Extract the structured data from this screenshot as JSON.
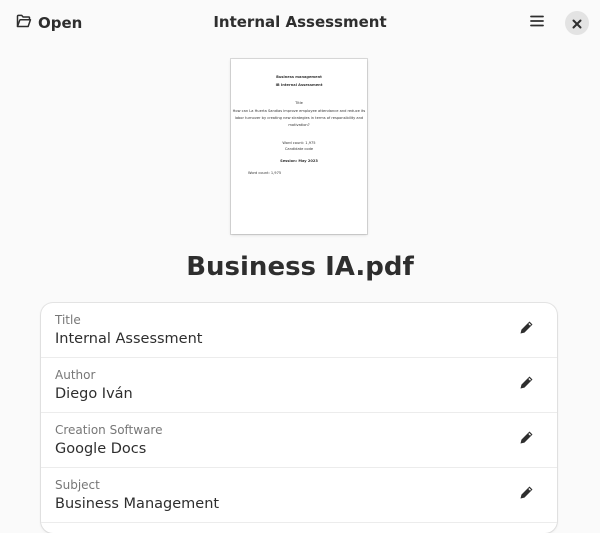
{
  "header": {
    "open_label": "Open",
    "title": "Internal Assessment",
    "open_icon": "folder-open-icon",
    "menu_icon": "menu-icon",
    "close_icon": "close-icon"
  },
  "thumbnail": {
    "lines": [
      "Business management",
      "IB Internal Assessment",
      "Title",
      "How can La Huerta Sandias improve employee attendance and reduce its",
      "labor turnover by creating new strategies in terms of responsibility and",
      "motivation?",
      "Word count: 1,975",
      "Candidate code",
      "Session: May 2023",
      "Word count: 1,975"
    ]
  },
  "file_name": "Business IA.pdf",
  "properties": [
    {
      "label": "Title",
      "value": "Internal Assessment"
    },
    {
      "label": "Author",
      "value": "Diego Iván"
    },
    {
      "label": "Creation Software",
      "value": "Google Docs"
    },
    {
      "label": "Subject",
      "value": "Business Management"
    }
  ],
  "colors": {
    "background": "#fafafa",
    "card": "#ffffff",
    "text": "#2e2e2e",
    "muted": "#777777"
  }
}
